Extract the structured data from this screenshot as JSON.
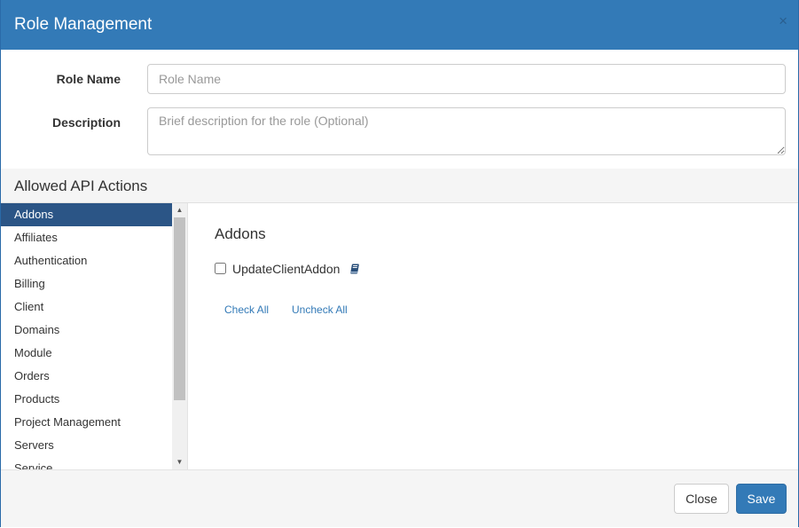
{
  "modal": {
    "title": "Role Management",
    "close_glyph": "×"
  },
  "form": {
    "role_name_label": "Role Name",
    "role_name_value": "",
    "role_name_placeholder": "Role Name",
    "description_label": "Description",
    "description_value": "",
    "description_placeholder": "Brief description for the role (Optional)"
  },
  "section": {
    "title": "Allowed API Actions"
  },
  "categories": [
    {
      "label": "Addons",
      "active": true
    },
    {
      "label": "Affiliates",
      "active": false
    },
    {
      "label": "Authentication",
      "active": false
    },
    {
      "label": "Billing",
      "active": false
    },
    {
      "label": "Client",
      "active": false
    },
    {
      "label": "Domains",
      "active": false
    },
    {
      "label": "Module",
      "active": false
    },
    {
      "label": "Orders",
      "active": false
    },
    {
      "label": "Products",
      "active": false
    },
    {
      "label": "Project Management",
      "active": false
    },
    {
      "label": "Servers",
      "active": false
    },
    {
      "label": "Service",
      "active": false
    }
  ],
  "scrollbar": {
    "up_glyph": "▲",
    "down_glyph": "▼"
  },
  "detail": {
    "title": "Addons",
    "actions": [
      {
        "label": "UpdateClientAddon",
        "checked": false,
        "icon": "book-icon"
      }
    ],
    "check_all_label": "Check All",
    "uncheck_all_label": "Uncheck All"
  },
  "footer": {
    "close_label": "Close",
    "save_label": "Save"
  },
  "colors": {
    "header_bg": "#337ab7",
    "active_item_bg": "#2b5586",
    "link": "#337ab7",
    "primary_button": "#337ab7"
  }
}
